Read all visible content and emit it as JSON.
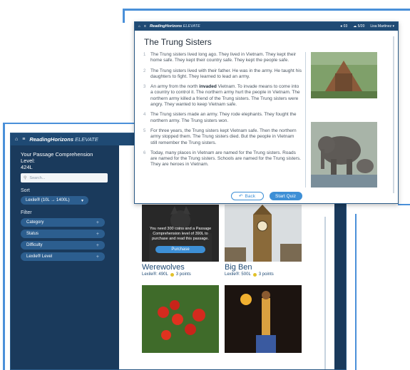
{
  "library": {
    "brand_reading": "ReadingHorizons",
    "brand_elevate": "ELEVATE",
    "menu_icon": "hamburger-icon",
    "home_icon": "home-icon",
    "level_label": "Your Passage Comprehension Level:",
    "level_value": "424L",
    "search_placeholder": "Search...",
    "sort_label": "Sort",
    "sort_value": "Lexile® (10L → 1400L)",
    "filter_label": "Filter",
    "filters": [
      "Category",
      "Status",
      "Difficulty",
      "Lexile® Level"
    ],
    "locked_message": "You need 300 coins and a Passage Comprehension level of 390L to purchase and read this passage.",
    "purchase_label": "Purchase",
    "tiles": [
      {
        "title": "Werewolves",
        "lexile": "Lexile®: 490L",
        "points": "3 points"
      },
      {
        "title": "Big Ben",
        "lexile": "Lexile®: 500L",
        "points": "3 points"
      }
    ],
    "point_color": "#e2c12a"
  },
  "story": {
    "brand_reading": "ReadingHorizons",
    "brand_elevate": "ELEVATE",
    "coins": "03",
    "points": "5/20",
    "user": "Lisa Martinez",
    "title": "The Trung Sisters",
    "paragraphs": [
      {
        "n": "1",
        "text": "The Trung sisters lived long ago. They lived in Vietnam. They kept their home safe. They kept their country safe. They kept the people safe."
      },
      {
        "n": "2",
        "text": "The Trung sisters lived with their father. He was in the army. He taught his daughters to fight. They learned to lead an army."
      },
      {
        "n": "3",
        "pre": "An army from the north ",
        "bold": "invaded",
        "post": " Vietnam. To invade means to come into a country to control it. The northern army hurt the people in Vietnam. The northern army killed a friend of the Trung sisters. The Trung sisters were angry. They wanted to keep Vietnam safe."
      },
      {
        "n": "4",
        "text": "The Trung sisters made an army. They rode elephants. They fought the northern army. The Trung sisters won."
      },
      {
        "n": "5",
        "text": "For three years, the Trung sisters kept Vietnam safe. Then the northern army stopped them. The Trung sisters died. But the people in Vietnam still remember the Trung sisters."
      },
      {
        "n": "6",
        "text": "Today, many places in Vietnam are named for the Trung sisters. Roads are named for the Trung sisters. Schools are named for the Trung sisters. They are heroes in Vietnam."
      }
    ],
    "back_label": "Back",
    "quiz_label": "Start Quiz",
    "accent": "#3d8fd6",
    "nav_color": "#1f4a74"
  }
}
